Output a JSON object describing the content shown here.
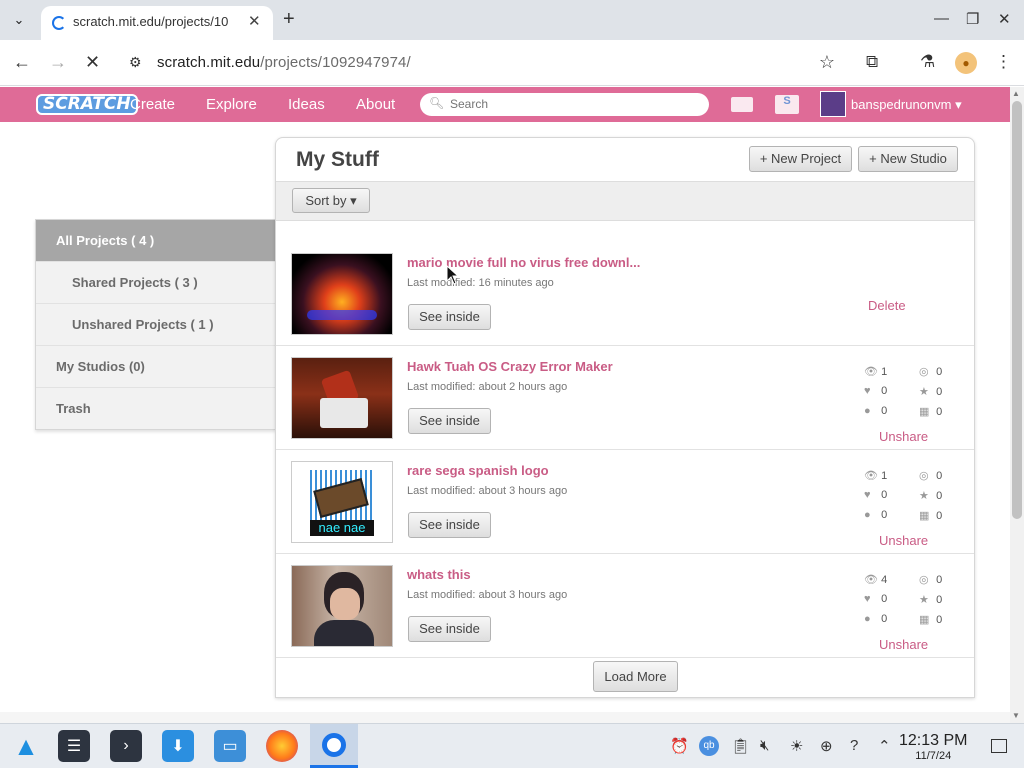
{
  "browser": {
    "tab_title": "scratch.mit.edu/projects/10",
    "url_host": "scratch.mit.edu",
    "url_path": "/projects/1092947974/"
  },
  "header": {
    "logo": "SCRATCH",
    "nav": [
      "Create",
      "Explore",
      "Ideas",
      "About"
    ],
    "search_placeholder": "Search",
    "username": "banspedrunonvm"
  },
  "sidebar": {
    "items": [
      {
        "label": "All Projects ( 4 )"
      },
      {
        "label": "Shared Projects ( 3 )"
      },
      {
        "label": "Unshared Projects ( 1 )"
      },
      {
        "label": "My Studios (0)"
      },
      {
        "label": "Trash"
      }
    ]
  },
  "main": {
    "title": "My Stuff",
    "new_project": "+ New Project",
    "new_studio": "+ New Studio",
    "sort_label": "Sort by",
    "see_inside": "See inside",
    "load_more": "Load More",
    "projects": [
      {
        "title": "mario movie full no virus free downl...",
        "modified": "Last modified: 16 minutes ago",
        "action": "Delete"
      },
      {
        "title": "Hawk Tuah OS Crazy Error Maker",
        "modified": "Last modified: about 2 hours ago",
        "action": "Unshare",
        "stats": {
          "views": "1",
          "remixes": "0",
          "loves": "0",
          "favorites": "0",
          "comments": "0",
          "studios": "0"
        }
      },
      {
        "title": "rare sega spanish logo",
        "modified": "Last modified: about 3 hours ago",
        "action": "Unshare",
        "stats": {
          "views": "1",
          "remixes": "0",
          "loves": "0",
          "favorites": "0",
          "comments": "0",
          "studios": "0"
        }
      },
      {
        "title": "whats this",
        "modified": "Last modified: about 3 hours ago",
        "action": "Unshare",
        "stats": {
          "views": "4",
          "remixes": "0",
          "loves": "0",
          "favorites": "0",
          "comments": "0",
          "studios": "0"
        }
      }
    ]
  },
  "thumb3_text": "nae nae",
  "taskbar": {
    "time": "12:13 PM",
    "date": "11/7/24"
  },
  "colors": {
    "scratch_header": "#df6b97",
    "link": "#c95c85"
  }
}
